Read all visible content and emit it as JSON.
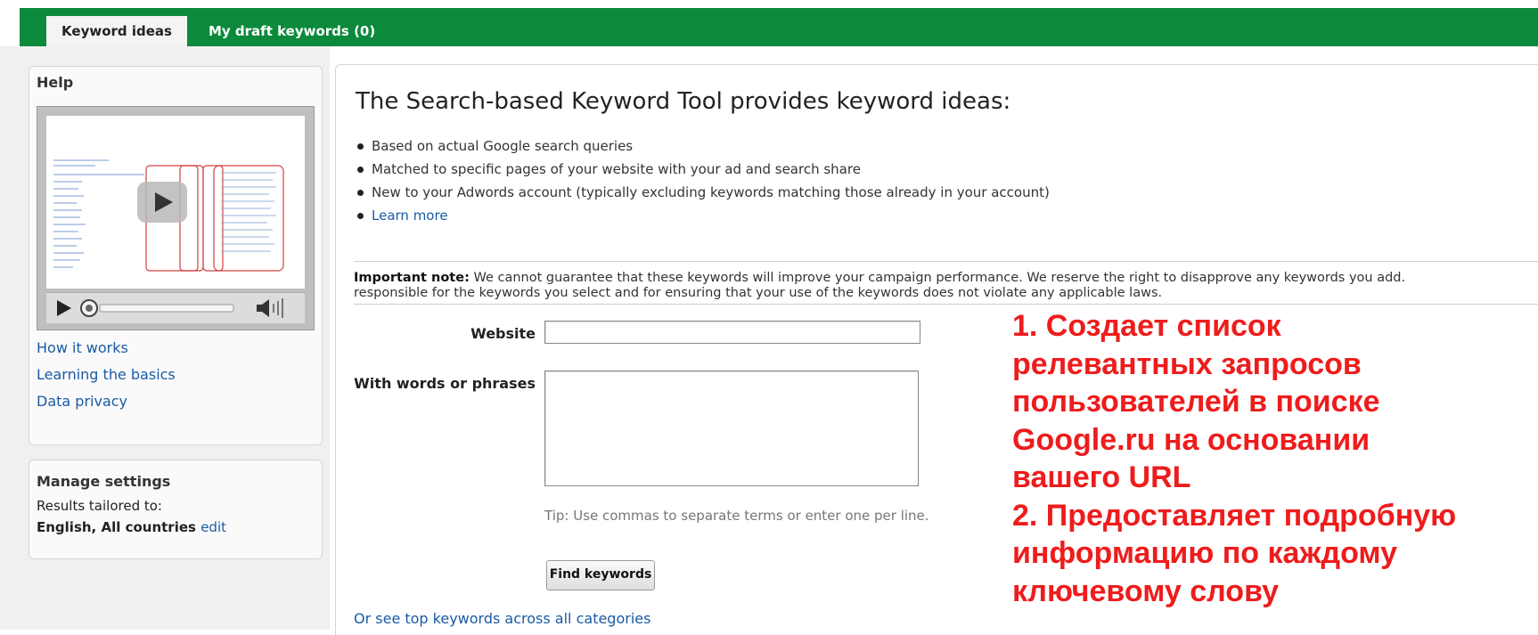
{
  "tabs": [
    {
      "label": "Keyword ideas",
      "active": true
    },
    {
      "label": "My draft keywords (0)",
      "active": false
    }
  ],
  "help": {
    "title": "Help",
    "links": [
      "How it works",
      "Learning the basics",
      "Data privacy"
    ]
  },
  "settings": {
    "title": "Manage settings",
    "results_label": "Results tailored to:",
    "results_value": "English, All countries",
    "edit_label": "edit"
  },
  "main": {
    "title": "The Search-based Keyword Tool provides keyword ideas:",
    "bullets": [
      "Based on actual Google search queries",
      "Matched to specific pages of your website with your ad and search share",
      "New to your Adwords account (typically excluding keywords matching those already in your account)"
    ],
    "learn_more": "Learn more",
    "note_label": "Important note:",
    "note_line1": "We cannot guarantee that these keywords will improve your campaign performance. We reserve the right to disapprove any keywords you add.",
    "note_line2": "responsible for the keywords you select and for ensuring that your use of the keywords does not violate any applicable laws."
  },
  "form": {
    "website_label": "Website",
    "website_value": "",
    "words_label": "With words or phrases",
    "words_value": "",
    "tip": "Tip: Use commas to separate terms or enter one per line.",
    "find_button": "Find keywords",
    "see_top_link": "Or see top keywords across all categories"
  },
  "annotation": {
    "color": "#ee1c1c",
    "lines": [
      "1. Создает список",
      "релевантных запросов",
      "пользователей в поиске",
      "Google.ru на основании",
      "вашего URL",
      "2. Предоставляет подробную",
      "информацию по каждому",
      "ключевому слову"
    ]
  },
  "colors": {
    "tab_bar": "#0b8a3c",
    "link": "#1a5aa6"
  }
}
